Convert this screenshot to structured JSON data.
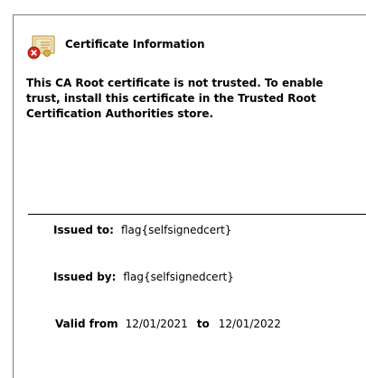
{
  "header": {
    "title": "Certificate Information",
    "icon": "certificate-error-icon"
  },
  "warning": {
    "text": "This CA Root certificate is not trusted. To enable trust, install this certificate in the Trusted Root Certification Authorities store."
  },
  "details": {
    "issued_to_label": "Issued to:",
    "issued_to_value": "flag{selfsignedcert}",
    "issued_by_label": "Issued by:",
    "issued_by_value": "flag{selfsignedcert}",
    "valid_from_label": "Valid from",
    "valid_from_value": "12/01/2021",
    "valid_to_label": "to",
    "valid_to_value": "12/01/2022"
  },
  "colors": {
    "error_red": "#d02b1f",
    "certificate_tan": "#e3cfa0"
  }
}
